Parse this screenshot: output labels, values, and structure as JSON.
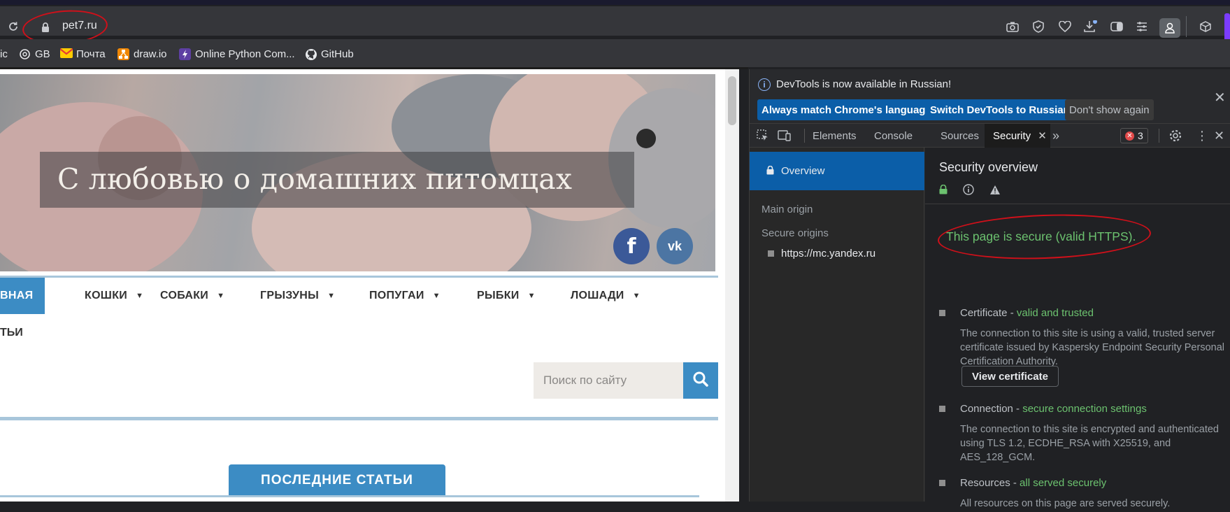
{
  "browser": {
    "url": "pet7.ru",
    "bookmarks": [
      {
        "label": "ic",
        "icon": "folder-icon"
      },
      {
        "label": "GB",
        "icon": "openai-icon"
      },
      {
        "label": "Почта",
        "icon": "mail-icon"
      },
      {
        "label": "draw.io",
        "icon": "drawio-icon"
      },
      {
        "label": "Online Python Com...",
        "icon": "bolt-icon"
      },
      {
        "label": "GitHub",
        "icon": "github-icon"
      }
    ]
  },
  "site": {
    "hero_title": "С любовью о домашних питомцах",
    "social": {
      "facebook": "f",
      "vk": "vk"
    },
    "nav": {
      "active": "ВНАЯ",
      "items": [
        "КОШКИ",
        "СОБАКИ",
        "ГРЫЗУНЫ",
        "ПОПУГАИ",
        "РЫБКИ",
        "ЛОШАДИ"
      ],
      "second_row": "ТЬИ"
    },
    "search": {
      "placeholder": "Поиск по сайту"
    },
    "latest_tab": "ПОСЛЕДНИЕ СТАТЬИ"
  },
  "devtools": {
    "infobar": {
      "message": "DevTools is now available in Russian!",
      "btn_match": "Always match Chrome's language",
      "btn_switch": "Switch DevTools to Russian",
      "btn_dont": "Don't show again"
    },
    "tabs": [
      "Elements",
      "Console",
      "Sources",
      "Security"
    ],
    "error_count": "3",
    "sidebar": {
      "overview": "Overview",
      "main_origin": "Main origin",
      "secure_origins": "Secure origins",
      "origin_url": "https://mc.yandex.ru"
    },
    "main": {
      "title": "Security overview",
      "secure_summary": "This page is secure (valid HTTPS).",
      "certificate_label": "Certificate - ",
      "certificate_status": "valid and trusted",
      "certificate_desc": "The connection to this site is using a valid, trusted server certificate issued by Kaspersky Endpoint Security Personal Certification Authority.",
      "view_certificate": "View certificate",
      "connection_label": "Connection - ",
      "connection_status": "secure connection settings",
      "connection_desc": "The connection to this site is encrypted and authenticated using TLS 1.2, ECDHE_RSA with X25519, and AES_128_GCM.",
      "resources_label": "Resources - ",
      "resources_status": "all served securely",
      "resources_desc": "All resources on this page are served securely."
    }
  }
}
